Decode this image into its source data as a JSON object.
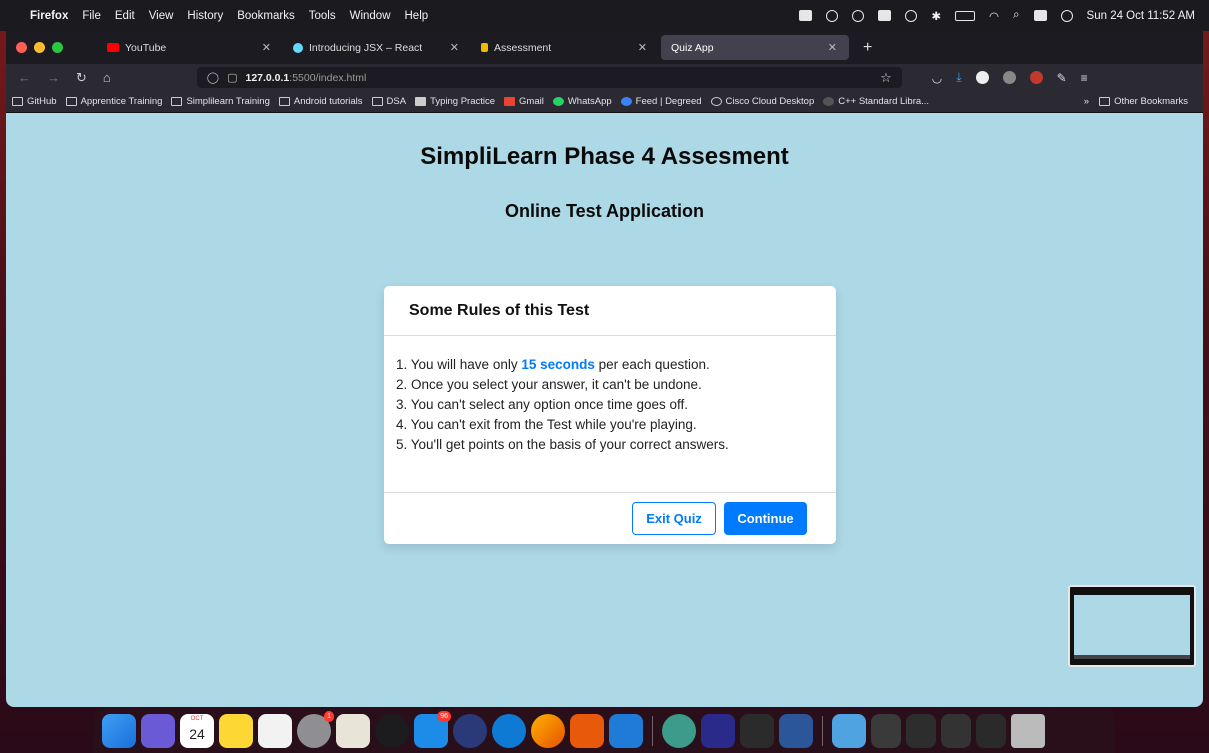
{
  "menubar": {
    "app": "Firefox",
    "items": [
      "File",
      "Edit",
      "View",
      "History",
      "Bookmarks",
      "Tools",
      "Window",
      "Help"
    ],
    "clock": "Sun 24 Oct  11:52 AM"
  },
  "tabs": [
    {
      "label": "YouTube",
      "color": "#ff0000"
    },
    {
      "label": "Introducing JSX – React",
      "color": "#61dafb"
    },
    {
      "label": "Assessment",
      "color": "#f5b800"
    },
    {
      "label": "Quiz App",
      "color": "#42414d"
    }
  ],
  "url": {
    "host": "127.0.0.1",
    "path": ":5500/index.html"
  },
  "bookmarks": [
    "GitHub",
    "Apprentice Training",
    "Simplilearn Training",
    "Android tutorials",
    "DSA",
    "Typing Practice",
    "Gmail",
    "WhatsApp",
    "Feed | Degreed",
    "Cisco Cloud Desktop",
    "C++ Standard Libra..."
  ],
  "bookmarks_other": "Other Bookmarks",
  "page": {
    "title": "SimpliLearn Phase 4 Assesment",
    "subtitle": "Online Test Application"
  },
  "rules": {
    "heading": "Some Rules of this Test",
    "rule1_prefix": "1. You will have only ",
    "rule1_highlight": "15 seconds",
    "rule1_suffix": " per each question.",
    "rule2": "2. Once you select your answer, it can't be undone.",
    "rule3": "3. You can't select any option once time goes off.",
    "rule4": "4. You can't exit from the Test while you're playing.",
    "rule5": "5. You'll get points on the basis of your correct answers.",
    "exit_label": "Exit Quiz",
    "continue_label": "Continue"
  },
  "dock": {
    "calendar_month": "OCT",
    "calendar_day": "24",
    "badge_messages": "1",
    "badge_mail": "96"
  },
  "colors": {
    "page_bg": "#add8e6",
    "accent": "#007bff"
  }
}
